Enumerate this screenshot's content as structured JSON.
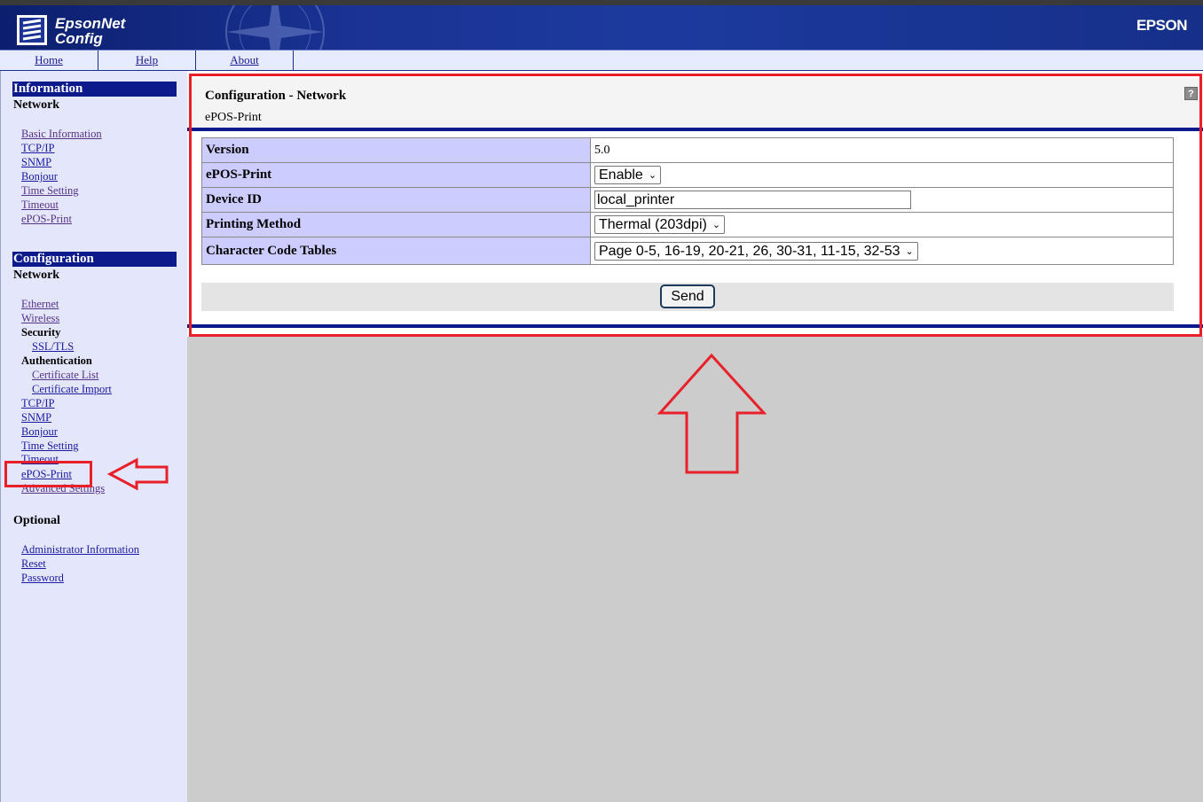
{
  "header": {
    "logo_line1": "EpsonNet",
    "logo_line2": "Config",
    "brand": "EPSON"
  },
  "nav": {
    "items": [
      "Home",
      "Help",
      "About"
    ]
  },
  "sidebar": {
    "information": {
      "title": "Information",
      "subheading": "Network",
      "links": [
        "Basic Information",
        "TCP/IP",
        "SNMP",
        "Bonjour",
        "Time Setting",
        "Timeout",
        "ePOS-Print"
      ]
    },
    "configuration": {
      "title": "Configuration",
      "subheading": "Network",
      "ethernet": "Ethernet",
      "wireless": "Wireless",
      "security": "Security",
      "ssl_tls": "SSL/TLS",
      "authentication": "Authentication",
      "certificate_list": "Certificate List",
      "certificate_import": "Certificate Import",
      "tcpip": "TCP/IP",
      "snmp": "SNMP",
      "bonjour": "Bonjour",
      "time_setting": "Time Setting",
      "timeout": "Timeout",
      "epos_print": "ePOS-Print",
      "advanced": "Advanced Settings"
    },
    "optional": {
      "title": "Optional",
      "links": [
        "Administrator Information",
        "Reset",
        "Password"
      ]
    }
  },
  "main": {
    "title": "Configuration - Network",
    "subtitle": "ePOS-Print",
    "help_icon": "?",
    "rows": [
      {
        "label": "Version",
        "value": "5.0"
      },
      {
        "label": "ePOS-Print",
        "value": "Enable"
      },
      {
        "label": "Device ID",
        "value": "local_printer"
      },
      {
        "label": "Printing Method",
        "value": "Thermal (203dpi)"
      },
      {
        "label": "Character Code Tables",
        "value": "Page 0-5, 16-19, 20-21, 26, 30-31, 11-15, 32-53"
      }
    ],
    "send_label": "Send"
  },
  "annotations": {
    "color": "#e8202a"
  }
}
